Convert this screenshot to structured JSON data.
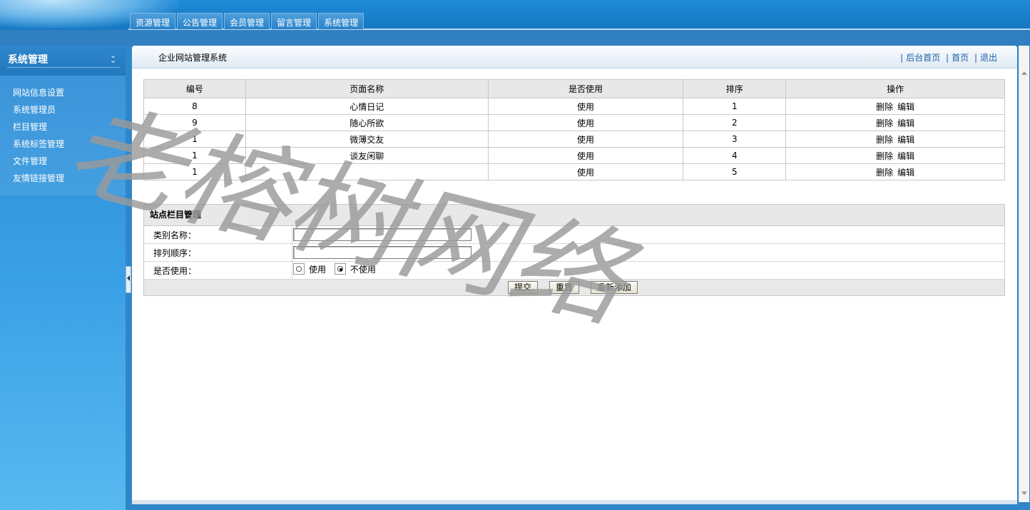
{
  "nav_tabs": [
    "资源管理",
    "公告管理",
    "会员管理",
    "留言管理",
    "系统管理"
  ],
  "sidebar": {
    "title": "系统管理",
    "items": [
      "网站信息设置",
      "系统管理员",
      "栏目管理",
      "系统标签管理",
      "文件管理",
      "友情链接管理"
    ]
  },
  "main": {
    "title": "企业网站管理系统",
    "links": [
      "后台首页",
      "首页",
      "退出"
    ]
  },
  "table": {
    "headers": [
      "编号",
      "页面名称",
      "是否使用",
      "排序",
      "操作"
    ],
    "rows": [
      {
        "id": "8",
        "name": "心情日记",
        "status": "使用",
        "order": "1"
      },
      {
        "id": "9",
        "name": "随心所欲",
        "status": "使用",
        "order": "2"
      },
      {
        "id": "1",
        "name": "微薄交友",
        "status": "使用",
        "order": "3"
      },
      {
        "id": "1",
        "name": "谈友闲聊",
        "status": "使用",
        "order": "4"
      },
      {
        "id": "1",
        "name": "",
        "status": "使用",
        "order": "5"
      }
    ],
    "actions": {
      "delete": "删除",
      "edit": "编辑"
    }
  },
  "form": {
    "title": "站点栏目管理",
    "name_label": "类别名称：",
    "name_value": "",
    "order_label": "排列顺序：",
    "order_value": "",
    "use_label": "是否使用：",
    "use_options": [
      "使用",
      "不使用"
    ],
    "use_selected": "不使用",
    "buttons": {
      "submit": "提交",
      "reset": "重置",
      "readd": "重新添加"
    }
  },
  "watermark": "老榕树网络",
  "colors": {
    "top_bar": "#1579c4",
    "sidebar": "#3aa0e6",
    "link": "#1e5fa3",
    "grid_header": "#e8e8e8"
  }
}
